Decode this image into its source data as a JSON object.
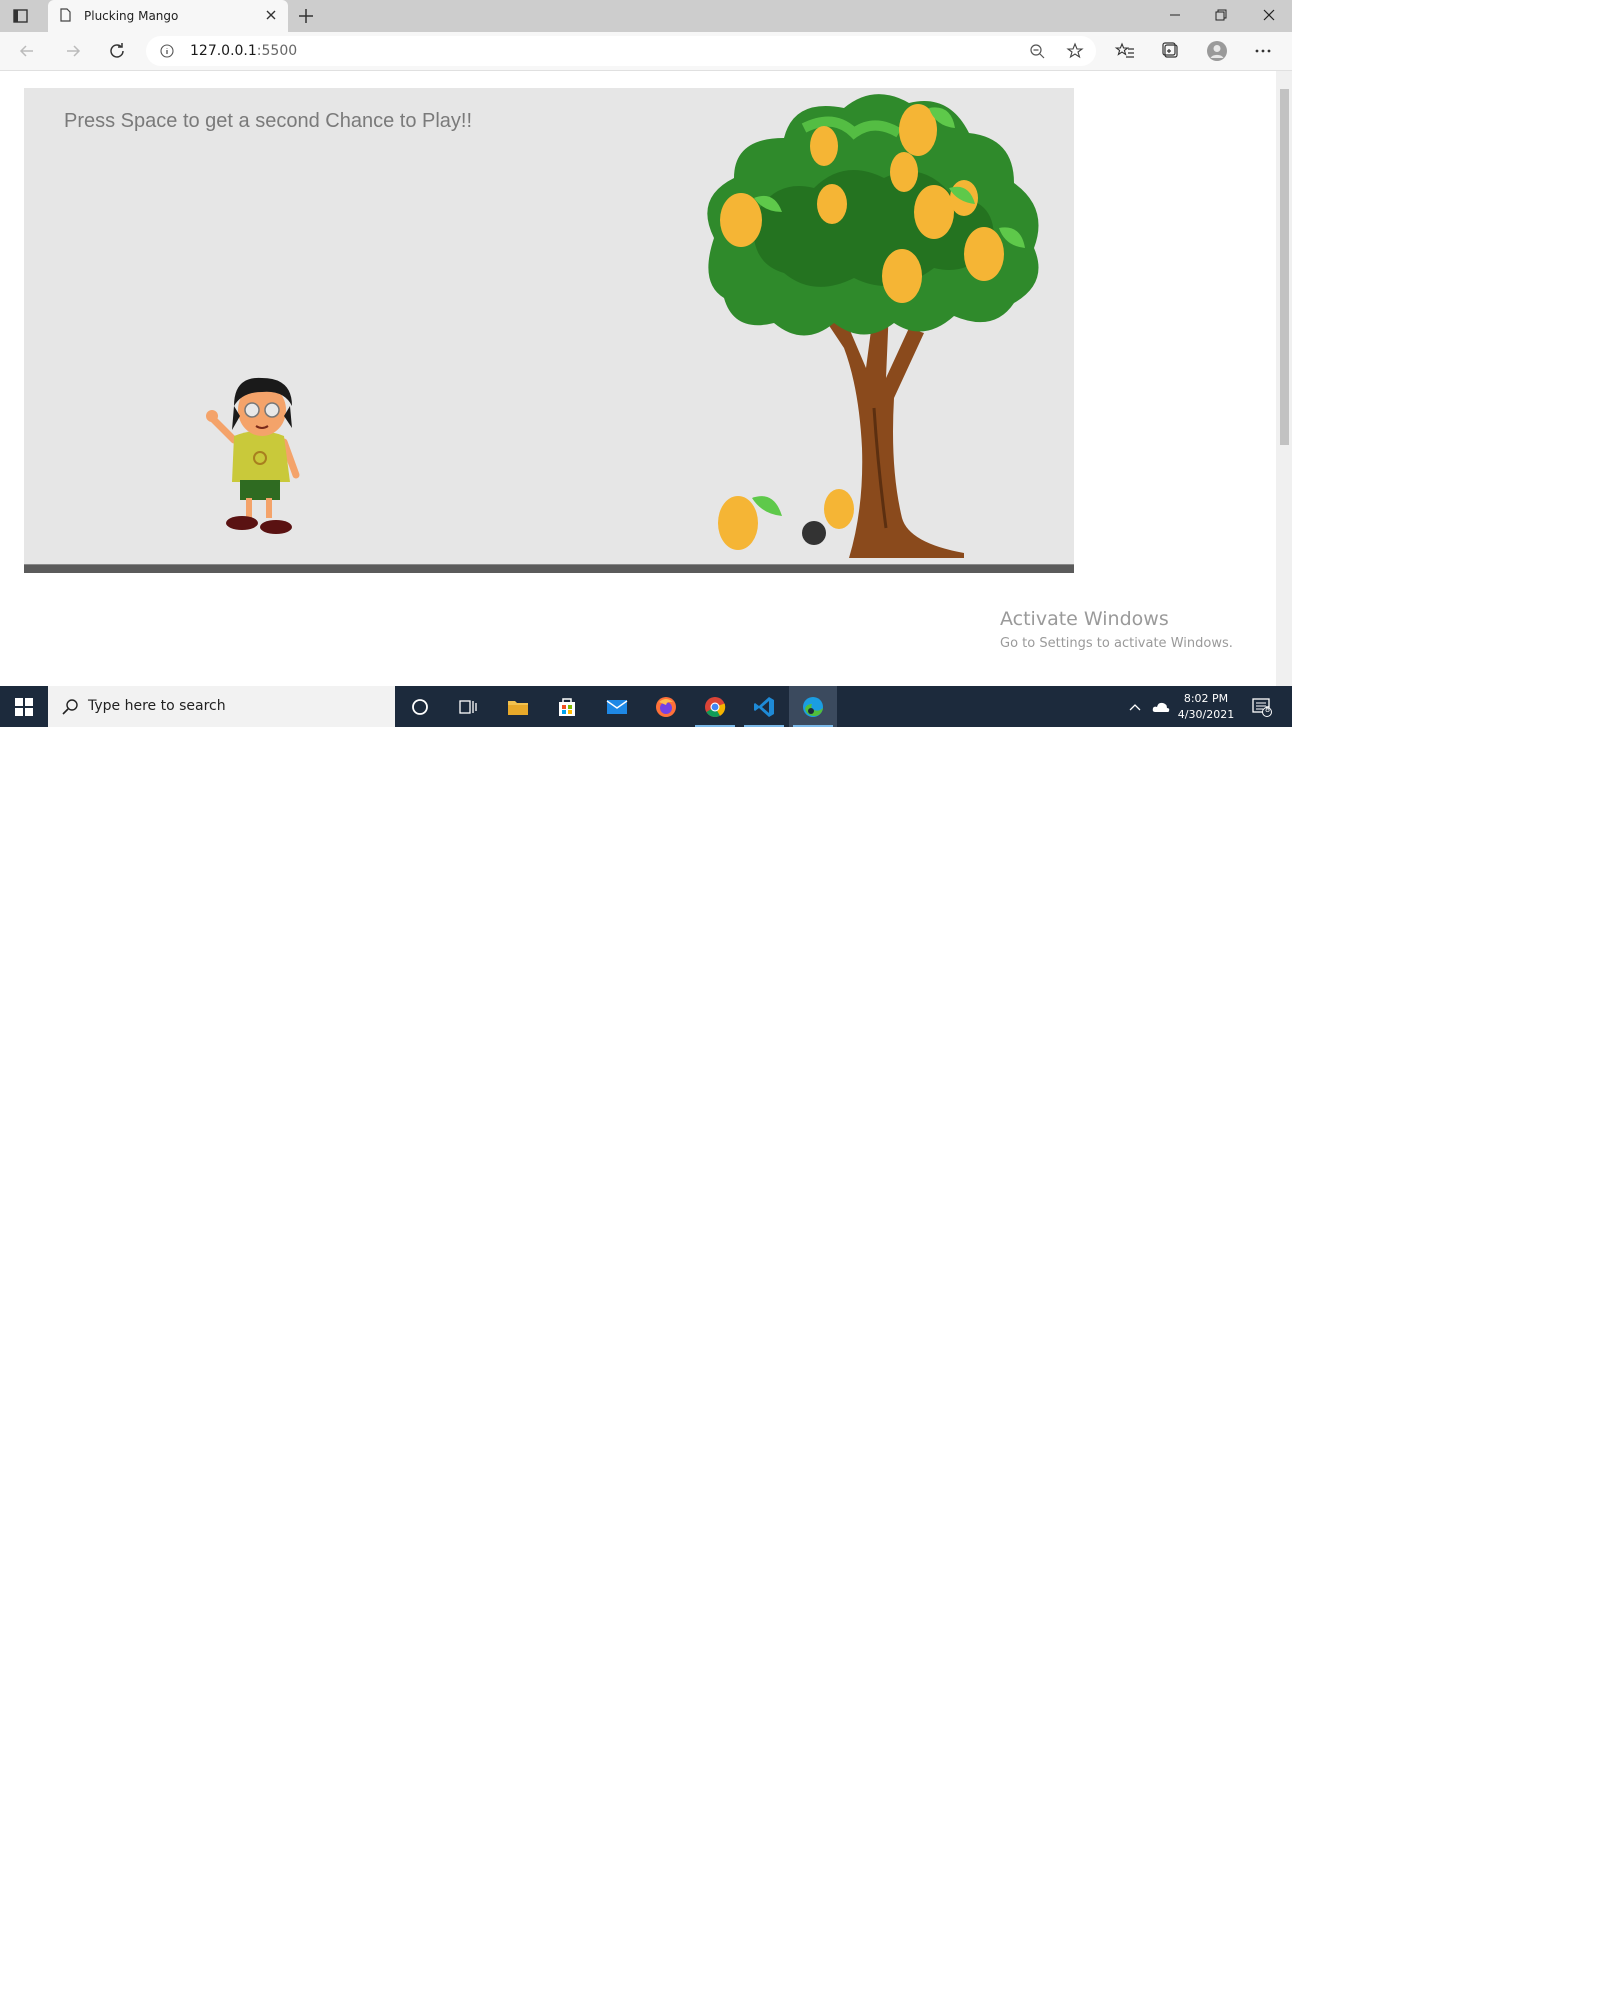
{
  "browser": {
    "tab_title": "Plucking Mango",
    "url_host": "127.0.0.1",
    "url_port": ":5500"
  },
  "game": {
    "hint_text": "Press Space to get a second Chance to Play!!"
  },
  "watermark": {
    "title": "Activate Windows",
    "subtitle": "Go to Settings to activate Windows."
  },
  "taskbar": {
    "search_placeholder": "Type here to search",
    "time": "8:02 PM",
    "date": "4/30/2021",
    "notification_count": "8",
    "apps": [
      "cortana-icon",
      "task-view-icon",
      "file-explorer-icon",
      "store-icon",
      "mail-icon",
      "firefox-icon",
      "chrome-icon",
      "vscode-icon",
      "edge-icon"
    ]
  },
  "colors": {
    "canvas_bg": "#e6e6e6",
    "ground": "#5b5b5b",
    "mango": "#f5b535",
    "leaf": "#2f8a2b",
    "trunk": "#8a4a1c",
    "taskbar": "#1c2a3c"
  }
}
